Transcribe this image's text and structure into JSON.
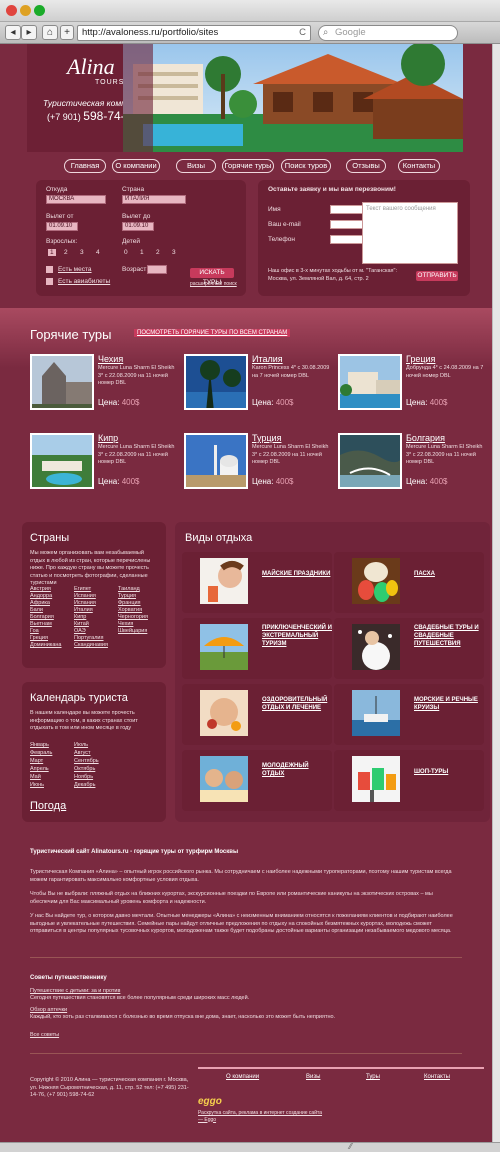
{
  "browser": {
    "url": "http://avaloness.ru/portfolio/sites",
    "search_placeholder": "Google",
    "back": "◂",
    "forward": "▸",
    "home": "⌂",
    "add": "+",
    "reload": "C"
  },
  "header": {
    "logo": "Alina",
    "logo_sub": "TOURS",
    "tagline": "Туристическая компания",
    "phone_prefix": "(+7 901)",
    "phone_number": "598-74-62"
  },
  "nav": [
    "Главная",
    "О компании",
    "Визы",
    "Горячие туры",
    "Поиск туров",
    "Отзывы",
    "Контакты"
  ],
  "search_form": {
    "from_label": "Откуда",
    "from_value": "МОСКВА",
    "country_label": "Страна",
    "country_value": "ИТАЛИЯ",
    "depart_from_label": "Вылет от",
    "depart_from_value": "01.09.10",
    "depart_to_label": "Вылет до",
    "depart_to_value": "01.09.10",
    "adults_label": "Взрослых:",
    "adults_options": [
      "1",
      "2",
      "3",
      "4"
    ],
    "children_label": "Детей",
    "children_options": [
      "0",
      "1",
      "2",
      "3"
    ],
    "seats_label": "Есть места",
    "tickets_label": "Есть авиабилеты",
    "age_label": "Возраст:",
    "search_button": "ИСКАТЬ ТУРЫ",
    "advanced_link": "расширенный поиск"
  },
  "callback_form": {
    "title": "Оставьте заявку и мы вам перезвоним!",
    "name_label": "Имя",
    "email_label": "Ваш e-mail",
    "phone_label": "Телефон",
    "message_placeholder": "Текст вашего сообщения",
    "address": "Наш офис в 3-х минутах ходьбы от м. \"Таганская\": Москва, ул. Земляной Вал, д. 64, стр. 2",
    "send_button": "ОТПРАВИТЬ"
  },
  "hot_tours": {
    "title": "Горячие туры",
    "all_link": "ПОСМОТРЕТЬ ГОРЯЧИЕ ТУРЫ ПО ВСЕМ СТРАНАМ",
    "items": [
      {
        "country": "Чехия",
        "desc": "Mercure Luna Sharm El Sheikh 3* с 22.08.2009 на 11 ночей номер DBL",
        "price_label": "Цена:",
        "price": "400$"
      },
      {
        "country": "Италия",
        "desc": "Karon Princess 4* с 30.08.2009 на 7 ночей номер DBL",
        "price_label": "Цена:",
        "price": "400$"
      },
      {
        "country": "Греция",
        "desc": "Добрунда 4* с 24.08.2009 на 7 ночей номер DBL",
        "price_label": "Цена:",
        "price": "400$"
      },
      {
        "country": "Кипр",
        "desc": "Mercure Luna Sharm El Sheikh 3* с 22.08.2009 на 11 ночей номер DBL",
        "price_label": "Цена:",
        "price": "400$"
      },
      {
        "country": "Турция",
        "desc": "Mercure Luna Sharm El Sheikh 3* с 22.08.2009 на 11 ночей номер DBL",
        "price_label": "Цена:",
        "price": "400$"
      },
      {
        "country": "Болгария",
        "desc": "Mercure Luna Sharm El Sheikh 3* с 22.08.2009 на 11 ночей номер DBL",
        "price_label": "Цена:",
        "price": "400$"
      }
    ]
  },
  "countries": {
    "title": "Страны",
    "intro": "Мы можем организовать вам незабываемый отдых в любой из стран, которые перечислены ниже. Про каждую страну вы можете прочесть статью и посмотреть фотографии, сделанные туристами",
    "col1": [
      "Австрия",
      "Андорра",
      "Африка",
      "Бали",
      "Болгария",
      "Вьетнам",
      "Гоа",
      "Греция",
      "Доминикана"
    ],
    "col2": [
      "Египет",
      "Испания",
      "Испания",
      "Италия",
      "Кипр",
      "Китай",
      "ОАЭ",
      "Португалия",
      "Скандинавия"
    ],
    "col3": [
      "Таиланд",
      "Турция",
      "Франция",
      "Хорватия",
      "Черногория",
      "Чехия",
      "Швейцария"
    ]
  },
  "calendar": {
    "title": "Календарь туриста",
    "intro": "В нашем календаре вы можете прочесть информацию о том, в каких странах стоит отдыхать в том или ином месяце в году",
    "col1": [
      "Январь",
      "Февраль",
      "Март",
      "Апрель",
      "Май",
      "Июнь"
    ],
    "col2": [
      "Июль",
      "Август",
      "Сентябрь",
      "Октябрь",
      "Ноябрь",
      "Декабрь"
    ],
    "bottom_link": "Погода"
  },
  "vacation_types": {
    "title": "Виды отдыха",
    "items": [
      "МАЙСКИЕ ПРАЗДНИКИ",
      "ПАСХА",
      "ПРИКЛЮЧЕНЧЕСКИЙ И ЭКСТРЕМАЛЬНЫЙ ТУРИЗМ",
      "СВАДЕБНЫЕ ТУРЫ И СВАДЕБНЫЕ ПУТЕШЕСТВИЯ",
      "ОЗДОРОВИТЕЛЬНЫЙ ОТДЫХ И ЛЕЧЕНИЕ",
      "МОРСКИЕ И РЕЧНЫЕ КРУИЗЫ",
      "МОЛОДЕЖНЫЙ ОТДЫХ",
      "ШОП-ТУРЫ"
    ]
  },
  "about": {
    "title": "Туристический сайт Alinatours.ru - горящие туры от турфирм Москвы",
    "p1": "Туристическая Компания «Алина» – опытный игрок российского рынка. Мы сотрудничаем с наиболее надежными туроператорами, поэтому нашим туристам всегда можем гарантировать максимально комфортные условия отдыха.",
    "p2": "Чтобы Вы не выбрали: пляжный отдых на ближних курортах, экскурсионные поездки по Европе или романтические каникулы на экзотических островах – мы обеспечим для Вас максимальный уровень комфорта и надежности.",
    "p3": "У нас Вы найдете тур, о котором давно мечтали. Опытные менеджеры «Алина» с неизменным вниманием относятся к пожеланиям клиентов и подбирают наиболее выгодные и увлекательные путешествия. Семейные пары найдут отличные предложения по отдыху на спокойных безмятежных курортах, молодежь сможет отправиться в центры популярных тусовочных курортов, молодоженам также будет подобраны достойные варианты организации незабываемого медового месяца."
  },
  "advice": {
    "title": "Советы путешественнику",
    "link1": "Путешествие с детьми: за и против",
    "text1": "Сегодня путешествия становятся все более популярным среди широких масс людей.",
    "link2": "Обзор аптечки",
    "text2": "Каждый, кто хоть раз сталкивался с болезнью во время отпуска вне дома, знает, насколько это может быть неприятно.",
    "all_link": "Все советы"
  },
  "footer": {
    "copyright": "Copyright © 2010 Алина — туристическая компания г. Москва, ул. Нижняя Сыромятническая, д. 11, стр. 52 тел: (+7 495) 231-14-76, (+7 901) 598-74-62",
    "links": [
      "О компании",
      "Визы",
      "Туры",
      "Контакты"
    ],
    "dev_logo": "eggo",
    "dev_text": "Раскрутка сайта, реклама в интернет создание сайта — Eggo"
  },
  "colors": {
    "bg": "#7a2a40",
    "panel": "#6b2034",
    "accent": "#c73a5c"
  }
}
